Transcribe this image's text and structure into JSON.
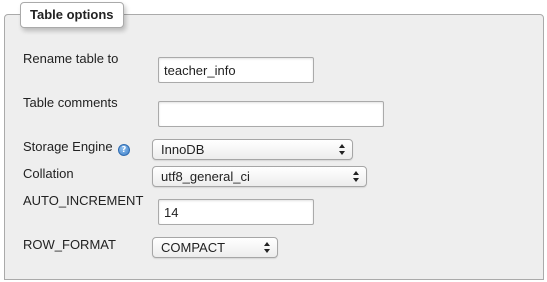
{
  "section": {
    "legend": "Table options"
  },
  "fields": {
    "rename_table": {
      "label": "Rename table to",
      "value": "teacher_info"
    },
    "table_comments": {
      "label": "Table comments",
      "value": ""
    },
    "storage_engine": {
      "label": "Storage Engine",
      "value": "InnoDB",
      "help_icon": "help-icon"
    },
    "collation": {
      "label": "Collation",
      "value": "utf8_general_ci"
    },
    "auto_increment": {
      "label": "AUTO_INCREMENT",
      "value": "14"
    },
    "row_format": {
      "label": "ROW_FORMAT",
      "value": "COMPACT"
    }
  },
  "colors": {
    "panel_background": "#eeeeee",
    "border": "#aaaaaa",
    "help_icon": "#3d7fc8"
  }
}
